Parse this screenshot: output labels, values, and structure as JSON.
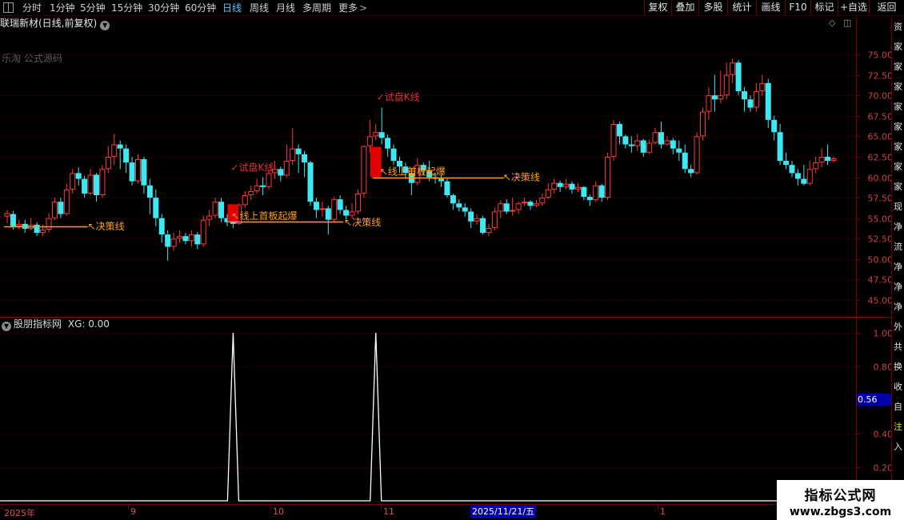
{
  "toolbar": {
    "periods": [
      "分时",
      "1分钟",
      "5分钟",
      "15分钟",
      "30分钟",
      "60分钟",
      "日线",
      "周线",
      "月线",
      "多周期",
      "更多"
    ],
    "active_period": "日线",
    "right_buttons": [
      "复权",
      "叠加",
      "多股",
      "统计",
      "画线",
      "F10",
      "标记",
      "+自选",
      "返回"
    ]
  },
  "header": {
    "title": "联瑞新材(日线,前复权)"
  },
  "watermark": "乐淘 公式源码",
  "main_chart": {
    "price_axis_labels": [
      "75.00",
      "72.50",
      "70.00",
      "67.50",
      "65.00",
      "62.50",
      "60.00",
      "57.50",
      "55.00",
      "52.50",
      "50.00",
      "47.50",
      "45.00"
    ],
    "annotations": {
      "trial_k_1": "✓试盘K线",
      "trial_k_2": "✓试盘K线",
      "breakout_1": "↖线上首板起爆",
      "breakout_2": "↖线上首板起爆",
      "decision_1": "↖决策线",
      "decision_2": "↖决策线",
      "decision_3": "↖决策线"
    },
    "colors": {
      "up": "#ff3a3a",
      "down": "#3ee8f2",
      "signal_bar": "#e00000",
      "decision_line": "#ffa020",
      "grid": "#7a0000"
    }
  },
  "indicator": {
    "name": "股朋指标网",
    "value_label": "XG: 0.00",
    "axis_labels": [
      "1.00",
      "0.80",
      "0.40",
      "0.20"
    ],
    "crosshair_value": "0.56"
  },
  "right_strip": [
    "资",
    "家",
    "家",
    "家",
    "家",
    "家",
    "家",
    "家",
    "家",
    "现",
    "净",
    "流",
    "净",
    "净",
    "净",
    "外",
    "共",
    "换",
    "收",
    "自",
    "注",
    "入"
  ],
  "date_axis": {
    "labels": [
      "2025年",
      "9",
      "10",
      "11",
      "1"
    ],
    "current": "2025/11/21/五"
  },
  "brand": {
    "title": "指标公式网",
    "url": "www.zbgs3.com"
  },
  "chart_data": {
    "type": "candlestick",
    "title": "联瑞新材(日线,前复权)",
    "ylim": [
      43.5,
      77.0
    ],
    "yticks": [
      75.0,
      72.5,
      70.0,
      67.5,
      65.0,
      62.5,
      60.0,
      57.5,
      55.0,
      52.5,
      50.0,
      47.5,
      45.0
    ],
    "candles": [
      [
        55.2,
        55.6,
        54.4,
        56.0
      ],
      [
        55.5,
        54.0,
        53.6,
        55.9
      ],
      [
        54.0,
        54.3,
        53.6,
        54.8
      ],
      [
        54.3,
        53.7,
        53.2,
        54.8
      ],
      [
        53.7,
        54.2,
        53.5,
        55.0
      ],
      [
        54.2,
        53.2,
        52.8,
        54.5
      ],
      [
        53.2,
        53.6,
        52.8,
        54.2
      ],
      [
        53.6,
        55.0,
        53.3,
        55.6
      ],
      [
        55.0,
        57.0,
        54.8,
        57.5
      ],
      [
        57.0,
        55.5,
        55.0,
        57.5
      ],
      [
        55.5,
        58.5,
        55.3,
        59.2
      ],
      [
        58.5,
        60.5,
        58.0,
        61.0
      ],
      [
        60.5,
        59.8,
        59.0,
        61.2
      ],
      [
        59.8,
        58.0,
        57.5,
        60.2
      ],
      [
        58.0,
        60.3,
        57.8,
        61.0
      ],
      [
        60.3,
        57.8,
        57.0,
        60.5
      ],
      [
        57.8,
        61.0,
        57.5,
        61.5
      ],
      [
        61.0,
        62.5,
        60.5,
        63.8
      ],
      [
        62.5,
        64.0,
        61.5,
        65.3
      ],
      [
        64.0,
        63.5,
        61.0,
        64.5
      ],
      [
        63.5,
        61.8,
        60.5,
        64.0
      ],
      [
        61.8,
        59.5,
        59.0,
        62.5
      ],
      [
        59.5,
        62.2,
        59.2,
        62.8
      ],
      [
        62.2,
        59.0,
        58.0,
        62.5
      ],
      [
        59.0,
        57.5,
        55.5,
        59.8
      ],
      [
        57.5,
        55.0,
        54.0,
        58.5
      ],
      [
        55.0,
        53.0,
        52.0,
        55.5
      ],
      [
        53.0,
        51.5,
        49.8,
        53.5
      ],
      [
        51.5,
        52.5,
        51.0,
        53.2
      ],
      [
        52.5,
        52.8,
        52.0,
        53.5
      ],
      [
        52.8,
        52.2,
        51.8,
        53.2
      ],
      [
        52.2,
        53.0,
        51.5,
        53.5
      ],
      [
        53.0,
        51.8,
        51.2,
        53.3
      ],
      [
        51.8,
        54.8,
        51.5,
        55.3
      ],
      [
        54.8,
        55.3,
        54.0,
        56.0
      ],
      [
        55.3,
        57.0,
        55.0,
        57.5
      ],
      [
        57.0,
        55.0,
        54.5,
        57.5
      ],
      [
        55.0,
        54.5,
        54.0,
        55.5
      ],
      [
        54.5,
        54.3,
        53.8,
        55.0
      ],
      [
        54.3,
        56.6,
        54.2,
        56.8
      ],
      [
        56.6,
        57.8,
        56.2,
        58.3
      ],
      [
        57.8,
        58.3,
        57.2,
        59.0
      ],
      [
        58.3,
        59.0,
        58.0,
        59.8
      ],
      [
        59.0,
        58.8,
        57.8,
        60.0
      ],
      [
        58.8,
        60.5,
        58.5,
        61.0
      ],
      [
        60.5,
        61.0,
        59.8,
        62.0
      ],
      [
        61.0,
        60.2,
        59.5,
        61.3
      ],
      [
        60.2,
        62.0,
        60.0,
        64.0
      ],
      [
        62.0,
        63.5,
        61.5,
        66.0
      ],
      [
        63.5,
        62.8,
        60.5,
        64.0
      ],
      [
        62.8,
        61.8,
        60.0,
        63.2
      ],
      [
        61.8,
        57.0,
        56.5,
        62.0
      ],
      [
        57.0,
        56.0,
        55.0,
        57.5
      ],
      [
        56.0,
        56.2,
        55.2,
        57.0
      ],
      [
        56.2,
        54.8,
        53.0,
        56.5
      ],
      [
        54.8,
        57.3,
        54.5,
        57.6
      ],
      [
        57.3,
        56.0,
        55.5,
        57.8
      ],
      [
        56.0,
        55.3,
        54.8,
        56.5
      ],
      [
        55.3,
        55.8,
        55.0,
        56.8
      ],
      [
        55.8,
        58.0,
        55.5,
        58.5
      ],
      [
        58.0,
        63.8,
        57.5,
        63.9
      ],
      [
        63.8,
        65.0,
        63.0,
        67.0
      ],
      [
        65.0,
        65.5,
        64.5,
        66.5
      ],
      [
        65.5,
        64.8,
        64.0,
        68.5
      ],
      [
        64.8,
        63.5,
        62.5,
        65.2
      ],
      [
        63.5,
        62.0,
        61.5,
        64.0
      ],
      [
        62.0,
        61.3,
        60.5,
        62.5
      ],
      [
        61.3,
        60.5,
        59.8,
        61.8
      ],
      [
        60.5,
        59.3,
        57.8,
        61.0
      ],
      [
        59.3,
        61.5,
        59.0,
        62.3
      ],
      [
        61.5,
        60.8,
        60.2,
        61.8
      ],
      [
        60.8,
        60.0,
        59.5,
        62.0
      ],
      [
        60.0,
        59.8,
        59.2,
        60.5
      ],
      [
        59.8,
        59.5,
        58.8,
        60.2
      ],
      [
        59.5,
        57.8,
        57.5,
        59.8
      ],
      [
        57.8,
        56.8,
        56.0,
        58.0
      ],
      [
        56.8,
        56.3,
        55.8,
        57.3
      ],
      [
        56.3,
        55.8,
        55.2,
        56.8
      ],
      [
        55.8,
        54.6,
        53.8,
        56.2
      ],
      [
        54.6,
        55.0,
        54.2,
        55.5
      ],
      [
        55.0,
        53.2,
        53.0,
        55.3
      ],
      [
        53.2,
        53.8,
        52.8,
        54.3
      ],
      [
        53.8,
        55.8,
        53.5,
        56.3
      ],
      [
        55.8,
        56.8,
        55.0,
        57.2
      ],
      [
        56.8,
        55.8,
        55.5,
        57.3
      ],
      [
        55.8,
        56.0,
        55.3,
        57.5
      ],
      [
        56.0,
        56.8,
        55.5,
        57.0
      ],
      [
        56.8,
        57.0,
        56.5,
        57.5
      ],
      [
        57.0,
        56.5,
        56.0,
        57.2
      ],
      [
        56.5,
        56.8,
        56.3,
        57.2
      ],
      [
        56.8,
        57.5,
        56.5,
        58.0
      ],
      [
        57.5,
        58.5,
        57.3,
        59.3
      ],
      [
        58.5,
        59.3,
        58.0,
        59.8
      ],
      [
        59.3,
        58.8,
        58.2,
        59.6
      ],
      [
        58.8,
        59.2,
        58.5,
        59.8
      ],
      [
        59.2,
        58.5,
        58.0,
        59.5
      ],
      [
        58.5,
        58.8,
        58.2,
        59.3
      ],
      [
        58.8,
        57.6,
        57.2,
        58.9
      ],
      [
        57.6,
        57.2,
        56.5,
        57.9
      ],
      [
        57.2,
        59.0,
        57.0,
        59.5
      ],
      [
        59.0,
        57.5,
        57.0,
        59.2
      ],
      [
        57.5,
        62.5,
        57.2,
        63.0
      ],
      [
        62.5,
        66.5,
        62.0,
        67.0
      ],
      [
        66.5,
        65.0,
        64.0,
        66.8
      ],
      [
        65.0,
        64.0,
        63.5,
        65.2
      ],
      [
        64.0,
        63.8,
        63.0,
        65.0
      ],
      [
        63.8,
        64.5,
        63.2,
        65.3
      ],
      [
        64.5,
        63.0,
        62.5,
        64.7
      ],
      [
        63.0,
        64.2,
        62.8,
        64.6
      ],
      [
        64.2,
        65.5,
        64.0,
        66.0
      ],
      [
        65.5,
        64.0,
        63.5,
        66.8
      ],
      [
        64.0,
        64.5,
        63.8,
        65.0
      ],
      [
        64.5,
        63.5,
        62.8,
        64.8
      ],
      [
        63.5,
        63.0,
        62.0,
        64.5
      ],
      [
        63.0,
        61.0,
        60.5,
        64.0
      ],
      [
        61.0,
        60.5,
        60.0,
        61.5
      ],
      [
        60.5,
        65.0,
        60.3,
        65.5
      ],
      [
        65.0,
        68.0,
        64.5,
        68.5
      ],
      [
        68.0,
        70.0,
        67.0,
        71.0
      ],
      [
        70.0,
        69.5,
        68.0,
        72.5
      ],
      [
        69.5,
        70.0,
        69.0,
        73.0
      ],
      [
        70.0,
        72.5,
        69.5,
        74.0
      ],
      [
        72.5,
        74.0,
        71.5,
        74.5
      ],
      [
        74.0,
        70.5,
        70.0,
        74.3
      ],
      [
        70.5,
        69.5,
        68.0,
        71.0
      ],
      [
        69.5,
        68.5,
        68.0,
        70.0
      ],
      [
        68.5,
        70.5,
        68.0,
        71.5
      ],
      [
        70.5,
        71.5,
        70.0,
        72.5
      ],
      [
        71.5,
        67.0,
        66.0,
        72.0
      ],
      [
        67.0,
        65.5,
        64.5,
        67.5
      ],
      [
        65.5,
        62.0,
        61.5,
        66.5
      ],
      [
        62.0,
        61.5,
        61.0,
        63.0
      ],
      [
        61.5,
        60.5,
        60.0,
        62.0
      ],
      [
        60.5,
        59.8,
        59.0,
        61.0
      ],
      [
        59.8,
        59.2,
        59.0,
        61.5
      ],
      [
        59.2,
        61.0,
        59.0,
        62.0
      ],
      [
        61.0,
        61.8,
        60.5,
        62.5
      ],
      [
        61.8,
        62.5,
        61.2,
        63.5
      ],
      [
        62.5,
        62.0,
        61.5,
        64.0
      ],
      [
        62.0,
        62.3,
        61.8,
        62.5
      ]
    ],
    "signal_bars": [
      {
        "index": 38,
        "low": 54.6,
        "high": 56.7
      },
      {
        "index": 62,
        "low": 60.0,
        "high": 63.7
      }
    ],
    "decision_lines": [
      {
        "from": 0,
        "to": 13,
        "price": 54.0
      },
      {
        "from": 38,
        "to": 56,
        "price": 54.6
      },
      {
        "from": 62,
        "to": 83,
        "price": 60.0
      }
    ],
    "indicator_series": {
      "name": "XG",
      "ylim": [
        0,
        1.05
      ],
      "peaks_at": [
        38,
        62
      ],
      "values": "0 everywhere except 1.00 at the two signal bars"
    }
  }
}
